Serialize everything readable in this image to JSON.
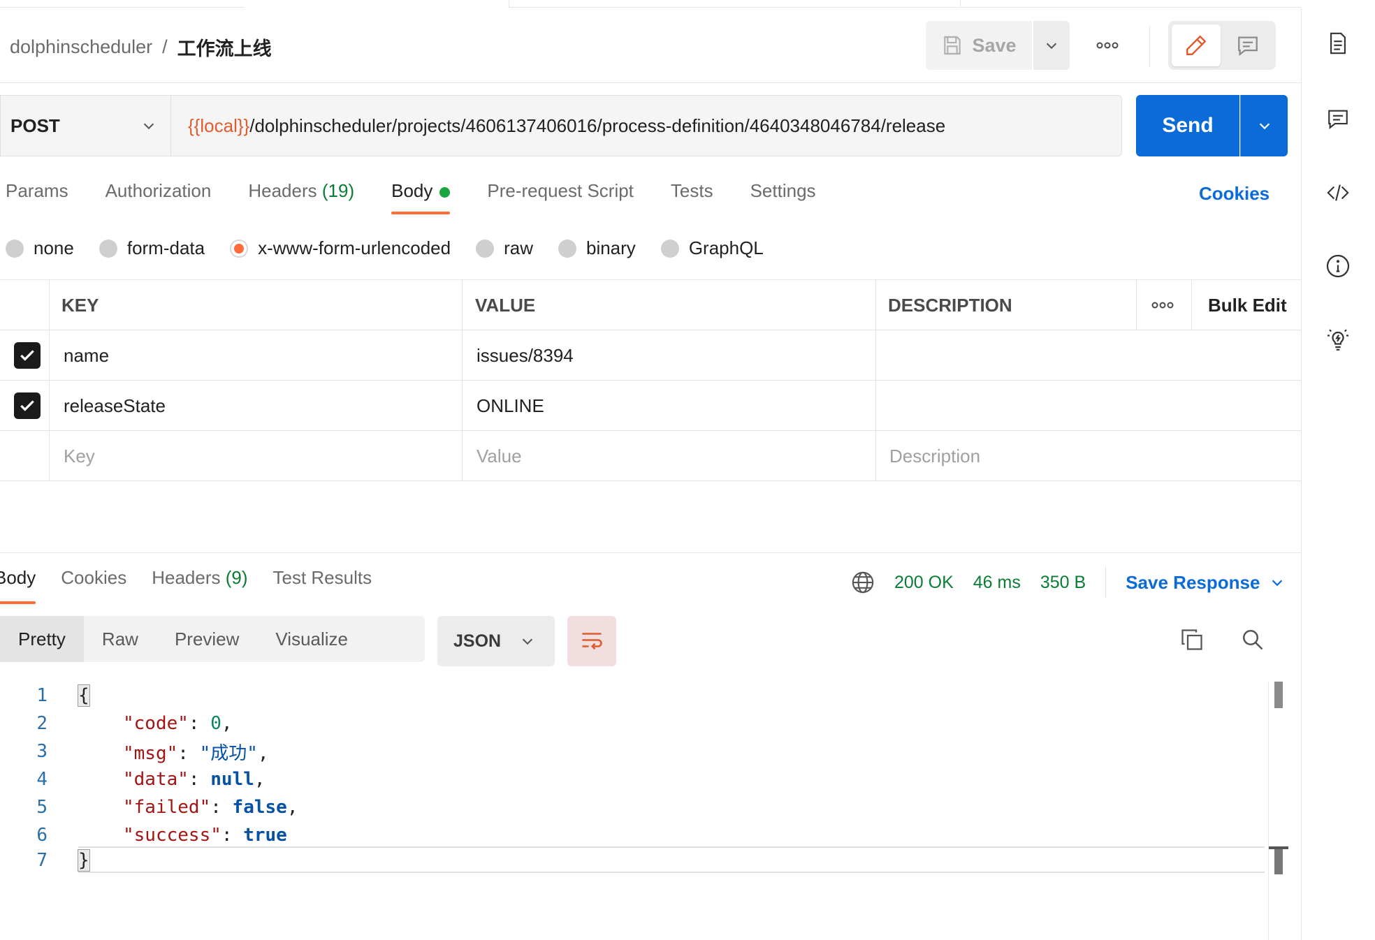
{
  "header": {
    "workspace": "dolphinscheduler",
    "separator": "/",
    "request_name": "工作流上线",
    "save_label": "Save"
  },
  "request": {
    "method": "POST",
    "url_variable": "{{local}}",
    "url_path": "/dolphinscheduler/projects/4606137406016/process-definition/4640348046784/release",
    "send_label": "Send"
  },
  "request_tabs": [
    {
      "label": "Params",
      "count": ""
    },
    {
      "label": "Authorization",
      "count": ""
    },
    {
      "label": "Headers",
      "count": "(19)"
    },
    {
      "label": "Body",
      "count": ""
    },
    {
      "label": "Pre-request Script",
      "count": ""
    },
    {
      "label": "Tests",
      "count": ""
    },
    {
      "label": "Settings",
      "count": ""
    }
  ],
  "cookies_label": "Cookies",
  "body_types": [
    "none",
    "form-data",
    "x-www-form-urlencoded",
    "raw",
    "binary",
    "GraphQL"
  ],
  "body_type_selected": "x-www-form-urlencoded",
  "params_table": {
    "headers": {
      "key": "KEY",
      "value": "VALUE",
      "description": "DESCRIPTION",
      "bulk_edit": "Bulk Edit"
    },
    "rows": [
      {
        "checked": true,
        "key": "name",
        "value": "issues/8394",
        "description": ""
      },
      {
        "checked": true,
        "key": "releaseState",
        "value": "ONLINE",
        "description": ""
      }
    ],
    "placeholders": {
      "key": "Key",
      "value": "Value",
      "description": "Description"
    }
  },
  "response": {
    "tabs": [
      {
        "label": "Body",
        "count": ""
      },
      {
        "label": "Cookies",
        "count": ""
      },
      {
        "label": "Headers",
        "count": "(9)"
      },
      {
        "label": "Test Results",
        "count": ""
      }
    ],
    "status": "200 OK",
    "time": "46 ms",
    "size": "350 B",
    "save_response_label": "Save Response",
    "view_modes": [
      "Pretty",
      "Raw",
      "Preview",
      "Visualize"
    ],
    "language": "JSON",
    "code_lines": [
      {
        "num": "1",
        "text": "{"
      },
      {
        "num": "2",
        "key": "\"code\"",
        "value": "0",
        "kind": "n",
        "comma": ","
      },
      {
        "num": "3",
        "key": "\"msg\"",
        "value": "\"成功\"",
        "kind": "s",
        "comma": ","
      },
      {
        "num": "4",
        "key": "\"data\"",
        "value": "null",
        "kind": "b",
        "comma": ","
      },
      {
        "num": "5",
        "key": "\"failed\"",
        "value": "false",
        "kind": "b",
        "comma": ","
      },
      {
        "num": "6",
        "key": "\"success\"",
        "value": "true",
        "kind": "b",
        "comma": ""
      },
      {
        "num": "7",
        "text": "}"
      }
    ]
  },
  "colors": {
    "accent": "#ff6c37",
    "primary": "#0b6bd9",
    "success": "#0a7d34",
    "url_variable": "#e05c2c"
  }
}
